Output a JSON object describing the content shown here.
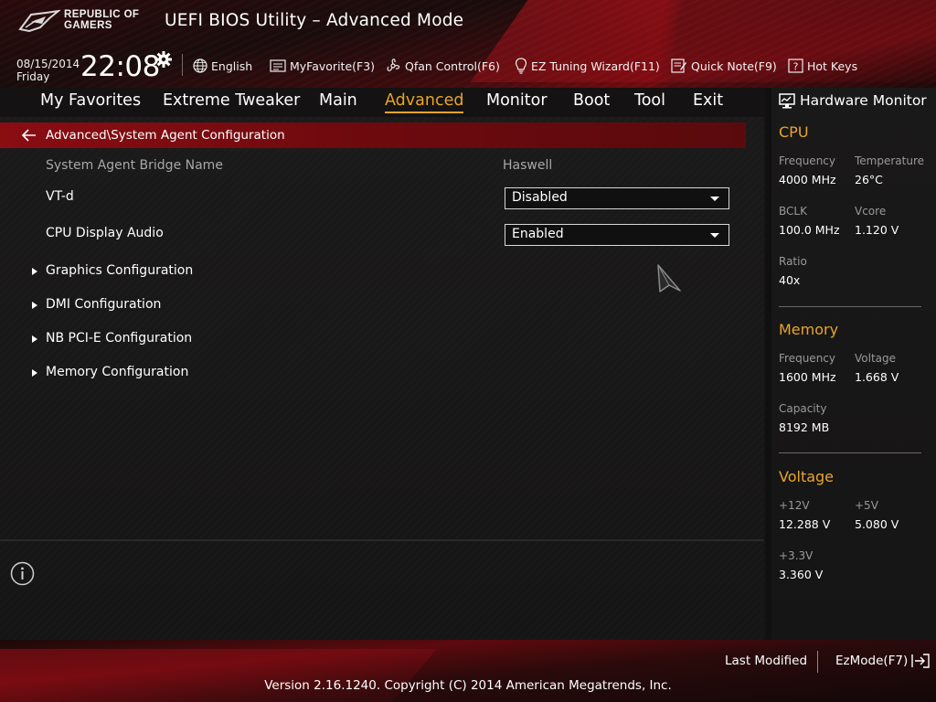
{
  "header": {
    "brand_line1": "REPUBLIC OF",
    "brand_line2": "GAMERS",
    "title": "UEFI BIOS Utility – Advanced Mode",
    "date": "08/15/2014",
    "day": "Friday",
    "time": "22:08",
    "toolbar": {
      "language": "English",
      "my_favorite": "MyFavorite(F3)",
      "qfan": "Qfan Control(F6)",
      "ez_tuning": "EZ Tuning Wizard(F11)",
      "quick_note": "Quick Note(F9)",
      "hot_keys": "Hot Keys"
    }
  },
  "tabs": [
    {
      "label": "My Favorites",
      "active": false
    },
    {
      "label": "Extreme Tweaker",
      "active": false
    },
    {
      "label": "Main",
      "active": false
    },
    {
      "label": "Advanced",
      "active": true
    },
    {
      "label": "Monitor",
      "active": false
    },
    {
      "label": "Boot",
      "active": false
    },
    {
      "label": "Tool",
      "active": false
    },
    {
      "label": "Exit",
      "active": false
    }
  ],
  "main": {
    "breadcrumb": "Advanced\\System Agent Configuration",
    "bridge_name_label": "System Agent Bridge Name",
    "bridge_name_value": "Haswell",
    "vtd_label": "VT-d",
    "vtd_value": "Disabled",
    "cpu_audio_label": "CPU Display Audio",
    "cpu_audio_value": "Enabled",
    "submenus": [
      "Graphics Configuration",
      "DMI Configuration",
      "NB PCI-E Configuration",
      "Memory Configuration"
    ]
  },
  "hardware_monitor": {
    "title": "Hardware Monitor",
    "cpu": {
      "section": "CPU",
      "frequency_label": "Frequency",
      "frequency_value": "4000 MHz",
      "temperature_label": "Temperature",
      "temperature_value": "26°C",
      "bclk_label": "BCLK",
      "bclk_value": "100.0 MHz",
      "vcore_label": "Vcore",
      "vcore_value": "1.120 V",
      "ratio_label": "Ratio",
      "ratio_value": "40x"
    },
    "memory": {
      "section": "Memory",
      "frequency_label": "Frequency",
      "frequency_value": "1600 MHz",
      "voltage_label": "Voltage",
      "voltage_value": "1.668 V",
      "capacity_label": "Capacity",
      "capacity_value": "8192 MB"
    },
    "voltage": {
      "section": "Voltage",
      "v12_label": "+12V",
      "v12_value": "12.288 V",
      "v5_label": "+5V",
      "v5_value": "5.080 V",
      "v33_label": "+3.3V",
      "v33_value": "3.360 V"
    }
  },
  "footer": {
    "last_modified": "Last Modified",
    "ez_mode": "EzMode(F7)",
    "version": "Version 2.16.1240. Copyright (C) 2014 American Megatrends, Inc."
  },
  "colors": {
    "accent": "#e8a52a",
    "breadcrumb_bar": "#8a0d12",
    "panel_bg": "#1b1a1a"
  },
  "icons": [
    "rog-logo-icon",
    "gear-icon",
    "globe-icon",
    "favorite-icon",
    "fan-icon",
    "bulb-icon",
    "note-icon",
    "help-icon",
    "back-arrow-icon",
    "monitor-icon",
    "info-icon",
    "mouse-cursor-icon",
    "exit-icon"
  ]
}
